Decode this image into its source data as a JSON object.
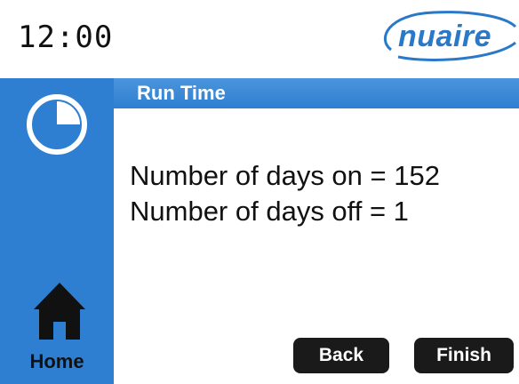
{
  "header": {
    "time": "12:00",
    "brand": "nuaire"
  },
  "sidebar": {
    "top_icon": "clock-icon",
    "home_icon": "home-icon",
    "home_label": "Home"
  },
  "screen": {
    "title": "Run Time",
    "days_on_line": "Number of days on = 152",
    "days_off_line": "Number of days off = 1"
  },
  "buttons": {
    "back_label": "Back",
    "finish_label": "Finish"
  },
  "colors": {
    "accent_blue": "#2e7fd1",
    "logo_blue": "#2a78c8",
    "button_black": "#1a1a1a"
  }
}
